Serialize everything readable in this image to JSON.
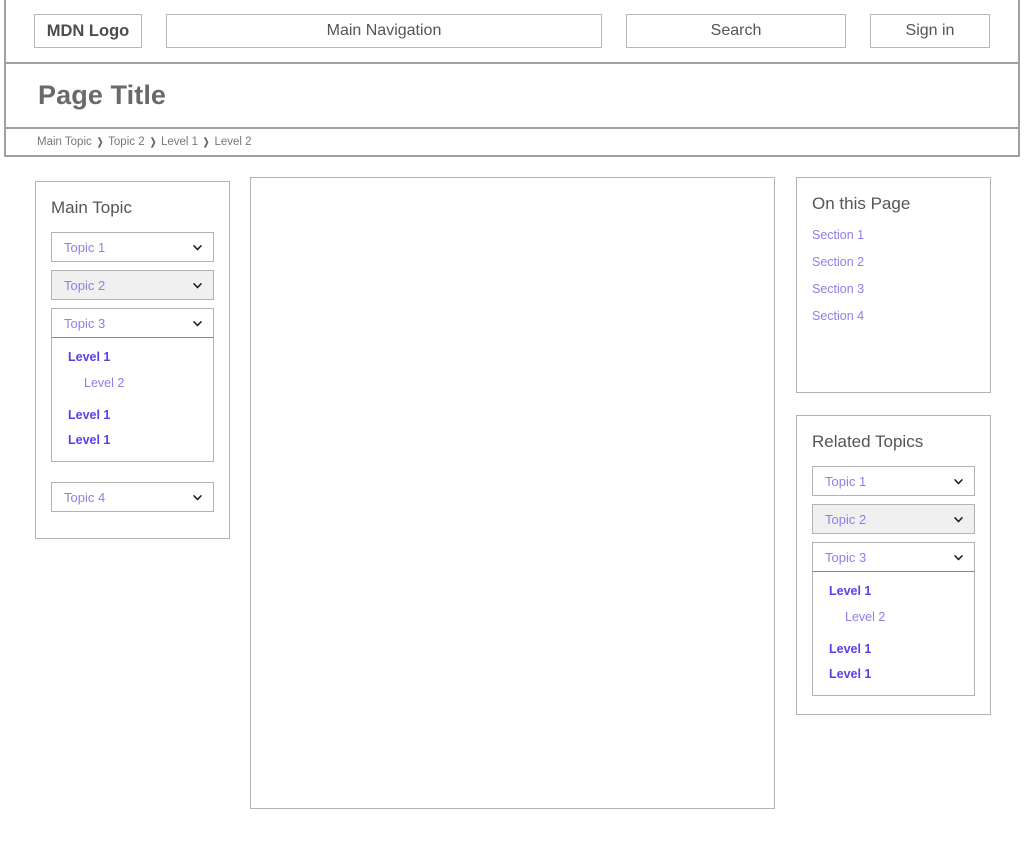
{
  "header": {
    "logo_label": "MDN Logo",
    "nav_label": "Main Navigation",
    "search_label": "Search",
    "signin_label": "Sign in"
  },
  "page": {
    "title": "Page Title"
  },
  "breadcrumb": {
    "separator": "❯",
    "items": [
      {
        "label": "Main Topic"
      },
      {
        "label": "Topic 2"
      },
      {
        "label": "Level 1"
      },
      {
        "label": "Level 2"
      }
    ]
  },
  "sidebar_left": {
    "title": "Main Topic",
    "topics": [
      {
        "label": "Topic 1",
        "state": "collapsed"
      },
      {
        "label": "Topic 2",
        "state": "selected"
      },
      {
        "label": "Topic 3",
        "state": "expanded"
      },
      {
        "label": "Topic 4",
        "state": "collapsed"
      }
    ],
    "expanded_children": [
      {
        "label": "Level 1",
        "level": 1
      },
      {
        "label": "Level 2",
        "level": 2
      },
      {
        "label": "Level 1",
        "level": 1
      },
      {
        "label": "Level 1",
        "level": 1
      }
    ]
  },
  "on_this_page": {
    "title": "On this Page",
    "links": [
      {
        "label": "Section 1"
      },
      {
        "label": "Section 2"
      },
      {
        "label": "Section 3"
      },
      {
        "label": "Section 4"
      }
    ]
  },
  "related_topics": {
    "title": "Related Topics",
    "topics": [
      {
        "label": "Topic 1",
        "state": "collapsed"
      },
      {
        "label": "Topic 2",
        "state": "selected"
      },
      {
        "label": "Topic 3",
        "state": "expanded"
      }
    ],
    "expanded_children": [
      {
        "label": "Level 1",
        "level": 1
      },
      {
        "label": "Level 2",
        "level": 2
      },
      {
        "label": "Level 1",
        "level": 1
      },
      {
        "label": "Level 1",
        "level": 1
      }
    ]
  },
  "main_content": {
    "body": ""
  },
  "colors": {
    "link": "#8c80e8",
    "link_strong": "#5b3fe8",
    "border": "#b3b3b3",
    "band_border": "#a0a0a0",
    "title_text": "#6a6a6a",
    "selected_bg": "#f0f0f0"
  }
}
